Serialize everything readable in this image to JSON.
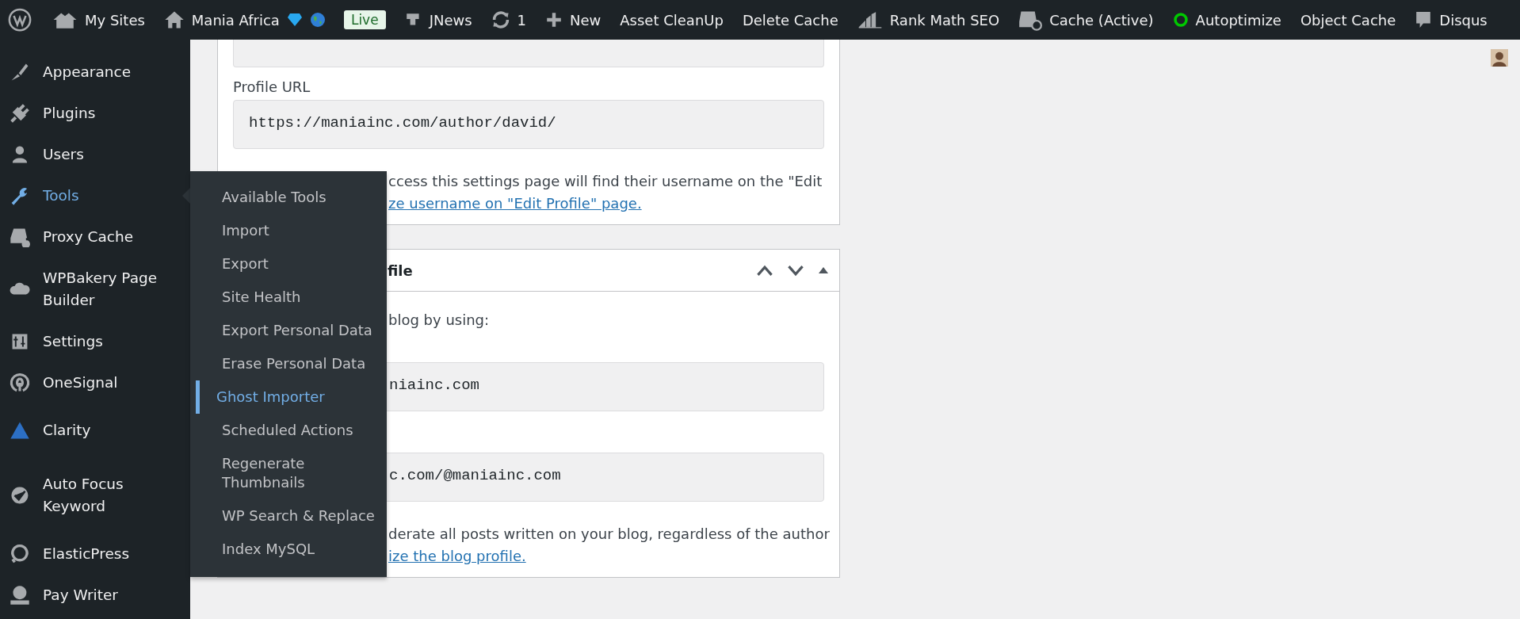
{
  "admin_bar": {
    "items": [
      {
        "label": "My Sites"
      },
      {
        "label": "Mania Africa"
      },
      {
        "label": "JNews"
      },
      {
        "label": "1"
      },
      {
        "label": "New"
      },
      {
        "label": "Asset CleanUp"
      },
      {
        "label": "Delete Cache"
      },
      {
        "label": "Rank Math SEO"
      },
      {
        "label": "Cache (Active)"
      },
      {
        "label": "Autoptimize"
      },
      {
        "label": "Object Cache"
      },
      {
        "label": "Disqus"
      }
    ],
    "badge": "Live"
  },
  "sidebar": {
    "items": [
      {
        "label": "Appearance",
        "selected": false
      },
      {
        "label": "Plugins",
        "selected": false
      },
      {
        "label": "Users",
        "selected": false
      },
      {
        "label": "Tools",
        "selected": true
      },
      {
        "label": "Proxy Cache",
        "selected": false
      },
      {
        "label": "WPBakery Page Builder",
        "selected": false
      },
      {
        "label": "Settings",
        "selected": false
      },
      {
        "label": "OneSignal",
        "selected": false
      },
      {
        "label": "Clarity",
        "selected": false
      },
      {
        "label": "Auto Focus Keyword",
        "selected": false
      },
      {
        "label": "ElasticPress",
        "selected": false
      },
      {
        "label": "Pay Writer",
        "selected": false
      }
    ]
  },
  "flyout": {
    "items": [
      {
        "label": "Available Tools",
        "selected": false
      },
      {
        "label": "Import",
        "selected": false
      },
      {
        "label": "Export",
        "selected": false
      },
      {
        "label": "Site Health",
        "selected": false
      },
      {
        "label": "Export Personal Data",
        "selected": false
      },
      {
        "label": "Erase Personal Data",
        "selected": false
      },
      {
        "label": "Ghost Importer",
        "selected": true
      },
      {
        "label": "Scheduled Actions",
        "selected": false
      },
      {
        "label": "Regenerate Thumbnails",
        "selected": false
      },
      {
        "label": "WP Search & Replace",
        "selected": false
      },
      {
        "label": "Index MySQL",
        "selected": false
      }
    ]
  },
  "panel_1": {
    "profile_url_label": "Profile URL",
    "profile_url": "https://maniainc.com/author/david/",
    "note": "ccess this settings page will find their username on the \"Edit",
    "link": "ze username on \"Edit Profile\" page."
  },
  "panel_2": {
    "title": "file",
    "intro": "blog by using:",
    "field_1": "niainc.com",
    "field_2": "c.com/@maniainc.com",
    "note": "derate all posts written on your blog, regardless of the author",
    "link": "ize the blog profile."
  }
}
